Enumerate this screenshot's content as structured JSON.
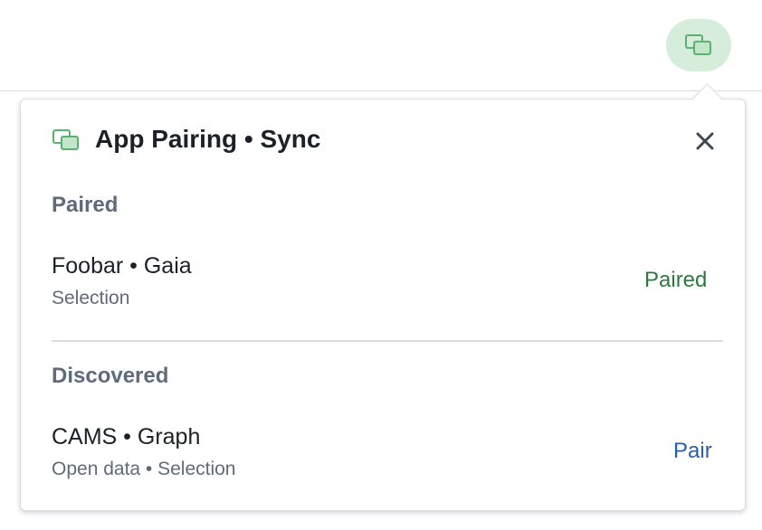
{
  "toolbar": {
    "icon": "app-pairing-icon",
    "accent_color": "#d7eddb"
  },
  "popover": {
    "title": "App Pairing • Sync",
    "icon": "app-pairing-icon",
    "close_icon": "close-icon"
  },
  "paired": {
    "heading": "Paired",
    "items": [
      {
        "name": "Foobar • Gaia",
        "tags": "Selection",
        "status": "Paired",
        "status_color": "#2d7a3e"
      }
    ]
  },
  "discovered": {
    "heading": "Discovered",
    "items": [
      {
        "name": "CAMS • Graph",
        "tags": "Open data • Selection",
        "action": "Pair",
        "action_color": "#2b5ea8"
      }
    ]
  }
}
